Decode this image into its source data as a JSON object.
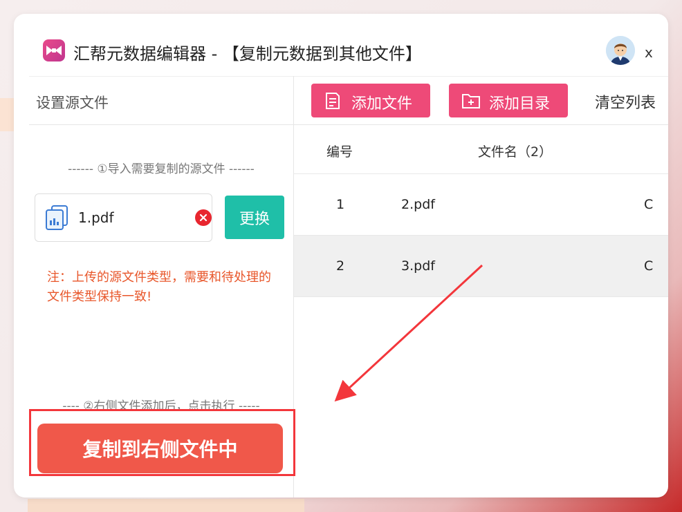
{
  "window": {
    "title": "汇帮元数据编辑器 - 【复制元数据到其他文件】",
    "close_glyph": "x"
  },
  "left_panel": {
    "header": "设置源文件",
    "step1": "------ ①导入需要复制的源文件 ------",
    "source_file": {
      "name": "1.pdf"
    },
    "replace_label": "更换",
    "note": "注：上传的源文件类型，需要和待处理的文件类型保持一致!",
    "step2": "---- ②右侧文件添加后，点击执行 -----",
    "copy_label": "复制到右侧文件中"
  },
  "toolbar": {
    "add_file_label": "添加文件",
    "add_dir_label": "添加目录",
    "clear_label": "清空列表"
  },
  "table": {
    "columns": {
      "index": "编号",
      "filename": "文件名（2）"
    },
    "rows": [
      {
        "index": "1",
        "name": "2.pdf",
        "extra": "C"
      },
      {
        "index": "2",
        "name": "3.pdf",
        "extra": "C"
      }
    ]
  },
  "colors": {
    "accent_pink": "#ee4a78",
    "teal": "#1fbfa8",
    "copy_button": "#f0584a",
    "note_orange": "#e8562a",
    "highlight_red": "#f3363b"
  }
}
